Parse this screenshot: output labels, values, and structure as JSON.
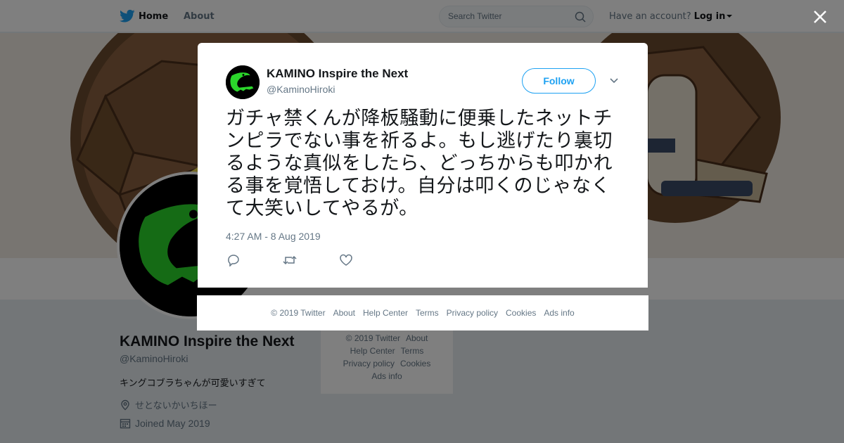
{
  "topbar": {
    "home_label": "Home",
    "about_label": "About",
    "search_placeholder": "Search Twitter",
    "account_prompt": "Have an account?",
    "login_label": "Log in"
  },
  "profile": {
    "name": "KAMINO Inspire the Next",
    "handle": "@KaminoHiroki",
    "bio": "キングコブラちゃんが可愛いすぎて",
    "location": "せとないかいちほー",
    "joined": "Joined May 2019"
  },
  "side_footer": {
    "row1": [
      "© 2019 Twitter",
      "About"
    ],
    "row2": [
      "Help Center",
      "Terms"
    ],
    "row3": [
      "Privacy policy",
      "Cookies"
    ],
    "row4": [
      "Ads info"
    ]
  },
  "tweet": {
    "author_name": "KAMINO Inspire the Next",
    "author_handle": "@KaminoHiroki",
    "follow_label": "Follow",
    "text": "ガチャ禁くんが降板騒動に便乗したネットチンピラでない事を祈るよ。もし逃げたり裏切るような真似をしたら、どっちからも叩かれる事を覚悟しておけ。自分は叩くのじゃなくて大笑いしてやるが。",
    "timestamp": "4:27 AM - 8 Aug 2019"
  },
  "modal_footer": {
    "links": [
      "© 2019 Twitter",
      "About",
      "Help Center",
      "Terms",
      "Privacy policy",
      "Cookies",
      "Ads info"
    ]
  },
  "colors": {
    "brand_blue": "#1da1f2",
    "avatar_green": "#2bd62b",
    "text_secondary": "#657786"
  },
  "icons": {
    "logo": "twitter-bird-icon",
    "search": "search-icon",
    "close": "close-icon",
    "more": "chevron-down-icon",
    "reply": "reply-icon",
    "retweet": "retweet-icon",
    "like": "heart-icon",
    "location": "location-pin-icon",
    "calendar": "calendar-icon"
  }
}
